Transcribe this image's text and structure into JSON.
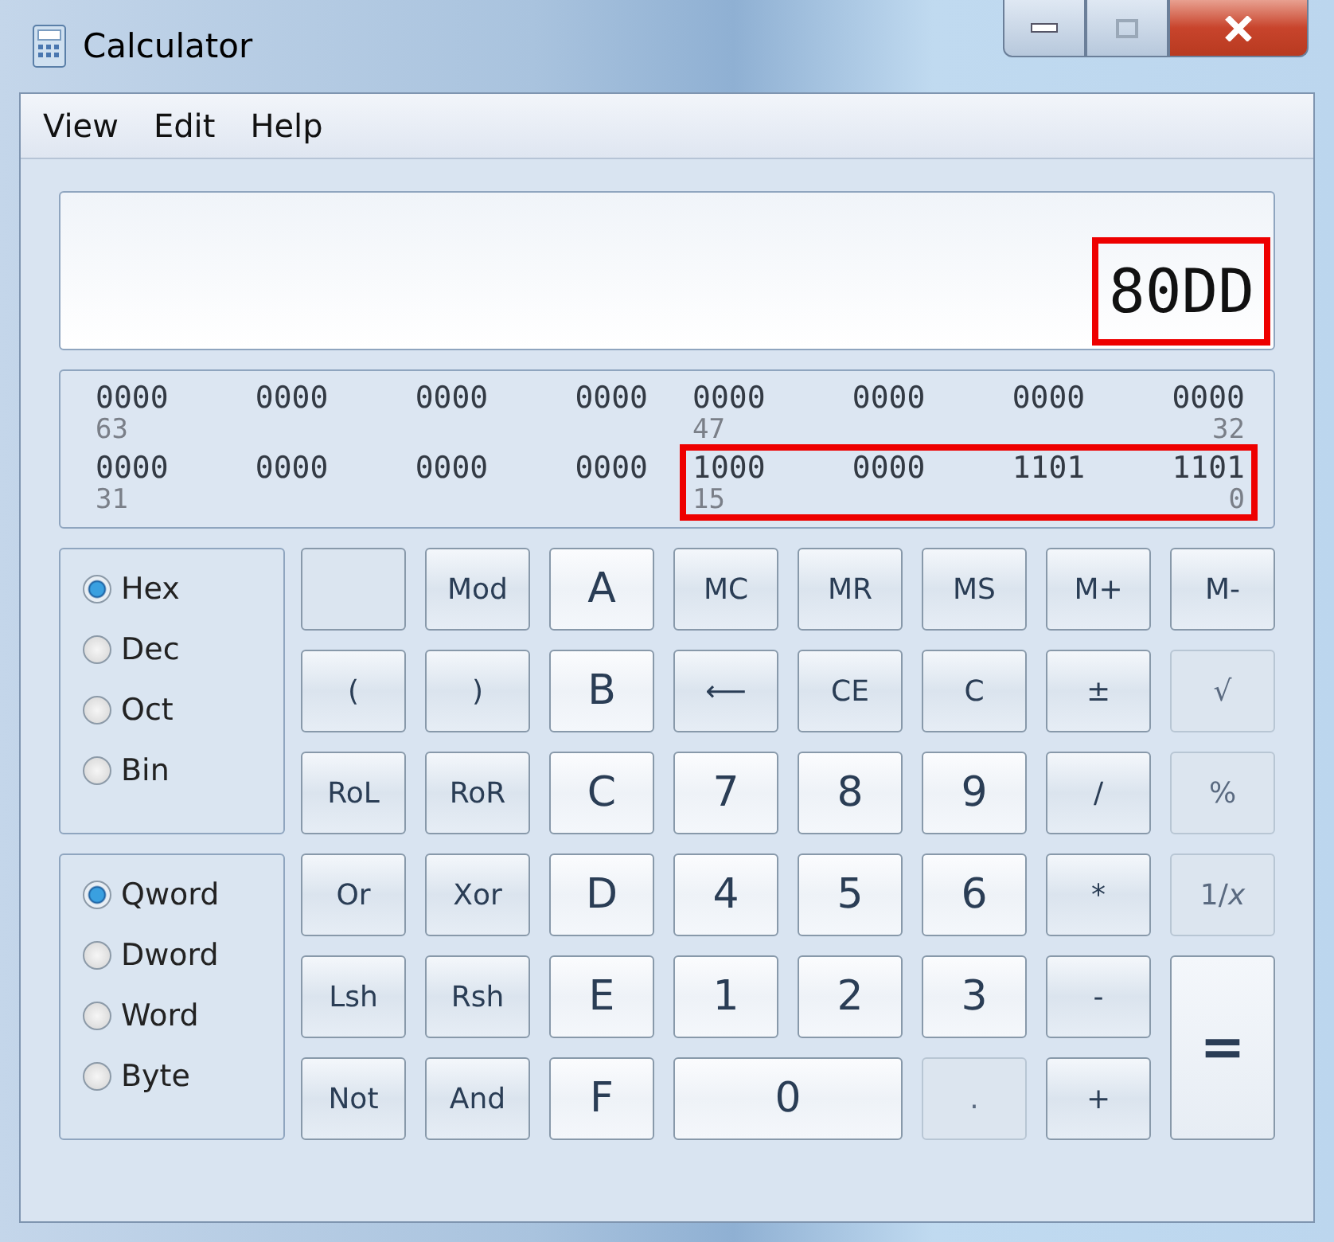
{
  "window": {
    "title": "Calculator"
  },
  "menu": [
    "View",
    "Edit",
    "Help"
  ],
  "display": {
    "value": "80DD",
    "highlighted": true
  },
  "bits": [
    {
      "halves": [
        {
          "groups": [
            "0000",
            "0000",
            "0000",
            "0000"
          ],
          "start_label": "63",
          "highlighted": false
        },
        {
          "groups": [
            "0000",
            "0000",
            "0000",
            "0000"
          ],
          "start_label": "47",
          "end_label": "32",
          "highlighted": false
        }
      ]
    },
    {
      "halves": [
        {
          "groups": [
            "0000",
            "0000",
            "0000",
            "0000"
          ],
          "start_label": "31",
          "highlighted": false
        },
        {
          "groups": [
            "1000",
            "0000",
            "1101",
            "1101"
          ],
          "start_label": "15",
          "end_label": "0",
          "highlighted": true
        }
      ]
    }
  ],
  "radio_groups": [
    {
      "options": [
        {
          "label": "Hex",
          "selected": true
        },
        {
          "label": "Dec",
          "selected": false
        },
        {
          "label": "Oct",
          "selected": false
        },
        {
          "label": "Bin",
          "selected": false
        }
      ]
    },
    {
      "options": [
        {
          "label": "Qword",
          "selected": true
        },
        {
          "label": "Dword",
          "selected": false
        },
        {
          "label": "Word",
          "selected": false
        },
        {
          "label": "Byte",
          "selected": false
        }
      ]
    }
  ],
  "keys": [
    {
      "kind": "blank"
    },
    {
      "kind": "op",
      "label": "Mod"
    },
    {
      "kind": "digit",
      "label": "A"
    },
    {
      "kind": "op",
      "label": "MC"
    },
    {
      "kind": "op",
      "label": "MR"
    },
    {
      "kind": "op",
      "label": "MS"
    },
    {
      "kind": "op",
      "label": "M+"
    },
    {
      "kind": "op",
      "label": "M-"
    },
    {
      "kind": "op",
      "label": "("
    },
    {
      "kind": "op",
      "label": ")"
    },
    {
      "kind": "digit",
      "label": "B"
    },
    {
      "kind": "op",
      "label": "⟵"
    },
    {
      "kind": "op",
      "label": "CE"
    },
    {
      "kind": "op",
      "label": "C"
    },
    {
      "kind": "op",
      "label": "±"
    },
    {
      "kind": "disabled",
      "label": "√"
    },
    {
      "kind": "op",
      "label": "RoL"
    },
    {
      "kind": "op",
      "label": "RoR"
    },
    {
      "kind": "digit",
      "label": "C"
    },
    {
      "kind": "digit",
      "label": "7"
    },
    {
      "kind": "digit",
      "label": "8"
    },
    {
      "kind": "digit",
      "label": "9"
    },
    {
      "kind": "op",
      "label": "/"
    },
    {
      "kind": "disabled",
      "label": "%"
    },
    {
      "kind": "op",
      "label": "Or"
    },
    {
      "kind": "op",
      "label": "Xor"
    },
    {
      "kind": "digit",
      "label": "D"
    },
    {
      "kind": "digit",
      "label": "4"
    },
    {
      "kind": "digit",
      "label": "5"
    },
    {
      "kind": "digit",
      "label": "6"
    },
    {
      "kind": "op",
      "label": "*"
    },
    {
      "kind": "disabled",
      "label": "1/*x*"
    },
    {
      "kind": "op",
      "label": "Lsh"
    },
    {
      "kind": "op",
      "label": "Rsh"
    },
    {
      "kind": "digit",
      "label": "E"
    },
    {
      "kind": "digit",
      "label": "1"
    },
    {
      "kind": "digit",
      "label": "2"
    },
    {
      "kind": "digit",
      "label": "3"
    },
    {
      "kind": "op",
      "label": "-"
    },
    {
      "kind": "equals",
      "label": "="
    },
    {
      "kind": "op",
      "label": "Not"
    },
    {
      "kind": "op",
      "label": "And"
    },
    {
      "kind": "digit",
      "label": "F"
    },
    {
      "kind": "zero",
      "label": "0"
    },
    {
      "kind": "disabled",
      "label": "."
    },
    {
      "kind": "op",
      "label": "+"
    }
  ]
}
